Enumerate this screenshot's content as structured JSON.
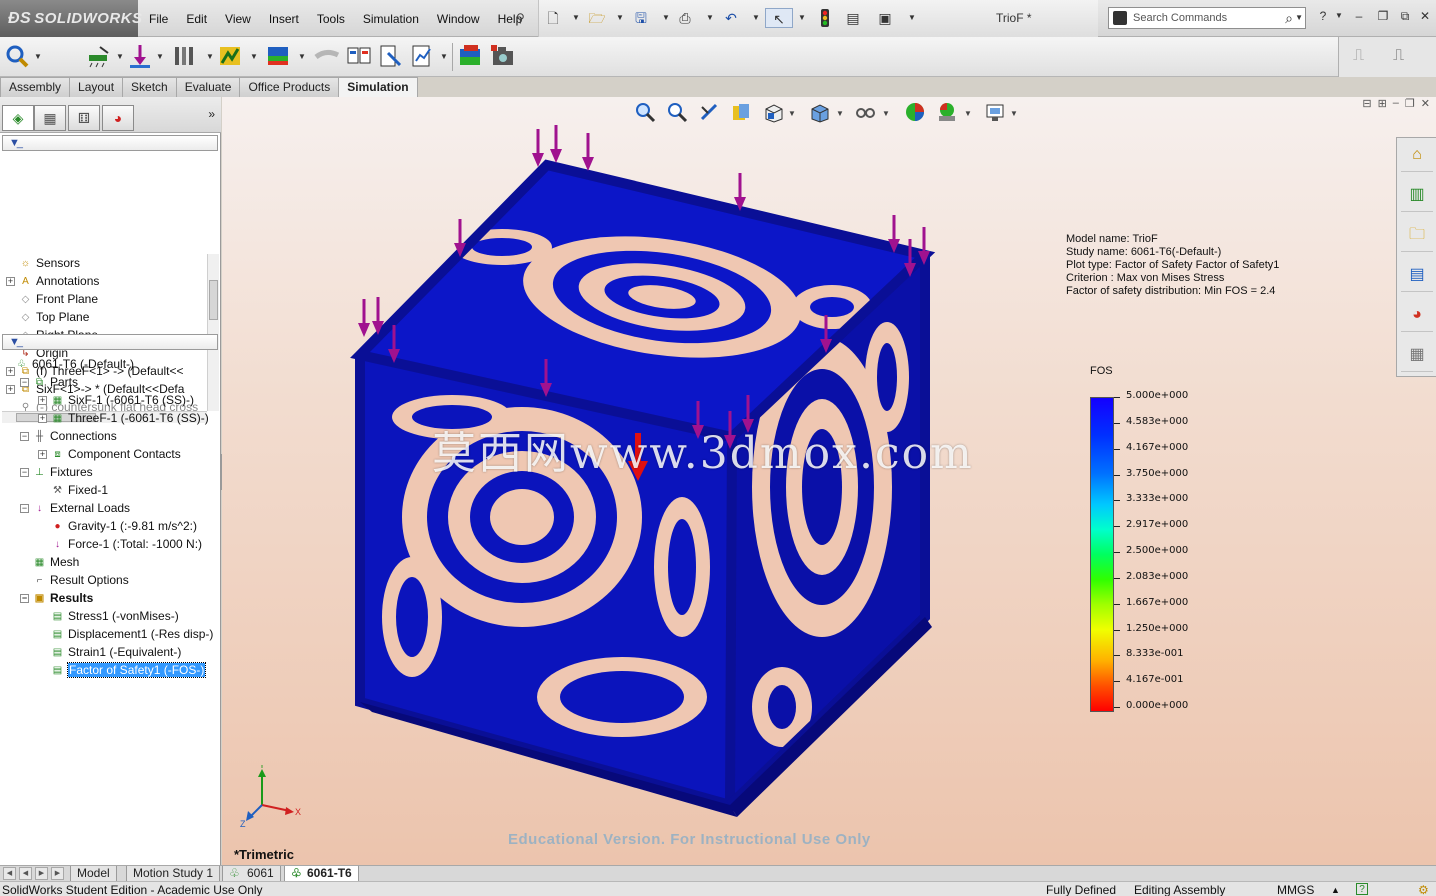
{
  "app": {
    "brand": "SOLIDWORKS",
    "document_title": "TrioF *"
  },
  "menu": [
    "File",
    "Edit",
    "View",
    "Insert",
    "Tools",
    "Simulation",
    "Window",
    "Help"
  ],
  "search": {
    "placeholder": "Search Commands"
  },
  "tabs": [
    {
      "label": "Assembly",
      "active": false
    },
    {
      "label": "Layout",
      "active": false
    },
    {
      "label": "Sketch",
      "active": false
    },
    {
      "label": "Evaluate",
      "active": false
    },
    {
      "label": "Office Products",
      "active": false
    },
    {
      "label": "Simulation",
      "active": true
    }
  ],
  "feature_tree": [
    {
      "label": "Sensors",
      "icon": "sensor-icon",
      "expandable": false,
      "greyed": false
    },
    {
      "label": "Annotations",
      "icon": "annotation-icon",
      "expandable": true,
      "greyed": false
    },
    {
      "label": "Front Plane",
      "icon": "plane-icon",
      "expandable": false,
      "greyed": false
    },
    {
      "label": "Top Plane",
      "icon": "plane-icon",
      "expandable": false,
      "greyed": false
    },
    {
      "label": "Right Plane",
      "icon": "plane-icon",
      "expandable": false,
      "greyed": false
    },
    {
      "label": "Origin",
      "icon": "origin-icon",
      "expandable": false,
      "greyed": false
    },
    {
      "label": "(f) ThreeF<1> -> (Default<<",
      "icon": "part-icon",
      "expandable": true,
      "greyed": false
    },
    {
      "label": "SixF<1>-> * (Default<<Defa",
      "icon": "part-icon",
      "expandable": true,
      "greyed": false
    },
    {
      "label": "(-) countersunk flat head cross",
      "icon": "screw-icon",
      "expandable": false,
      "greyed": true
    }
  ],
  "study_tree": [
    {
      "label": "6061-T6 (-Default-)",
      "icon": "study-icon",
      "indent": 0,
      "expandable": false,
      "bold": false,
      "selected": false
    },
    {
      "label": "Parts",
      "icon": "parts-icon",
      "indent": 1,
      "expandable": true,
      "bold": false,
      "selected": false
    },
    {
      "label": "SixF-1 (-6061-T6 (SS)-)",
      "icon": "mesh-part-icon",
      "indent": 2,
      "expandable": true,
      "bold": false,
      "selected": false
    },
    {
      "label": "ThreeF-1 (-6061-T6 (SS)-)",
      "icon": "mesh-part-icon",
      "indent": 2,
      "expandable": true,
      "bold": false,
      "selected": false
    },
    {
      "label": "Connections",
      "icon": "connections-icon",
      "indent": 1,
      "expandable": true,
      "bold": false,
      "selected": false
    },
    {
      "label": "Component Contacts",
      "icon": "contacts-icon",
      "indent": 2,
      "expandable": true,
      "bold": false,
      "selected": false
    },
    {
      "label": "Fixtures",
      "icon": "fixtures-icon",
      "indent": 1,
      "expandable": true,
      "bold": false,
      "selected": false
    },
    {
      "label": "Fixed-1",
      "icon": "fixed-icon",
      "indent": 2,
      "expandable": false,
      "bold": false,
      "selected": false
    },
    {
      "label": "External Loads",
      "icon": "loads-icon",
      "indent": 1,
      "expandable": true,
      "bold": false,
      "selected": false
    },
    {
      "label": "Gravity-1 (:-9.81 m/s^2:)",
      "icon": "gravity-icon",
      "indent": 2,
      "expandable": false,
      "bold": false,
      "selected": false
    },
    {
      "label": "Force-1 (:Total: -1000 N:)",
      "icon": "force-icon",
      "indent": 2,
      "expandable": false,
      "bold": false,
      "selected": false
    },
    {
      "label": "Mesh",
      "icon": "mesh-icon",
      "indent": 1,
      "expandable": false,
      "bold": false,
      "selected": false
    },
    {
      "label": "Result Options",
      "icon": "result-options-icon",
      "indent": 1,
      "expandable": false,
      "bold": false,
      "selected": false
    },
    {
      "label": "Results",
      "icon": "results-folder-icon",
      "indent": 1,
      "expandable": true,
      "bold": true,
      "selected": false
    },
    {
      "label": "Stress1 (-vonMises-)",
      "icon": "plot-icon",
      "indent": 2,
      "expandable": false,
      "bold": false,
      "selected": false
    },
    {
      "label": "Displacement1 (-Res disp-)",
      "icon": "plot-icon",
      "indent": 2,
      "expandable": false,
      "bold": false,
      "selected": false
    },
    {
      "label": "Strain1 (-Equivalent-)",
      "icon": "plot-icon",
      "indent": 2,
      "expandable": false,
      "bold": false,
      "selected": false
    },
    {
      "label": "Factor of Safety1 (-FOS-)",
      "icon": "plot-icon",
      "indent": 2,
      "expandable": false,
      "bold": false,
      "selected": true
    }
  ],
  "plot_info": [
    "Model name: TrioF",
    "Study name: 6061-T6(-Default-)",
    "Plot type: Factor of Safety Factor of Safety1",
    "Criterion : Max von Mises Stress",
    "Factor of safety distribution: Min FOS = 2.4"
  ],
  "legend": {
    "title": "FOS",
    "ticks": [
      "5.000e+000",
      "4.583e+000",
      "4.167e+000",
      "3.750e+000",
      "3.333e+000",
      "2.917e+000",
      "2.500e+000",
      "2.083e+000",
      "1.667e+000",
      "1.250e+000",
      "8.333e-001",
      "4.167e-001",
      "0.000e+000"
    ]
  },
  "viewport": {
    "view_name": "*Trimetric",
    "education_notice": "Educational Version. For Instructional Use Only",
    "watermark": "莫西网www.3dmox.com",
    "model_color": "#0a12b8",
    "load_arrow_color": "#a0128f"
  },
  "bottom_tabs": [
    {
      "label": "Model",
      "active": false
    },
    {
      "label": "Motion Study 1",
      "active": false
    },
    {
      "label": "6061",
      "active": false
    },
    {
      "label": "6061-T6",
      "active": true
    }
  ],
  "status": {
    "edition": "SolidWorks Student Edition - Academic Use Only",
    "definition": "Fully Defined",
    "mode": "Editing Assembly",
    "units": "MMGS"
  }
}
